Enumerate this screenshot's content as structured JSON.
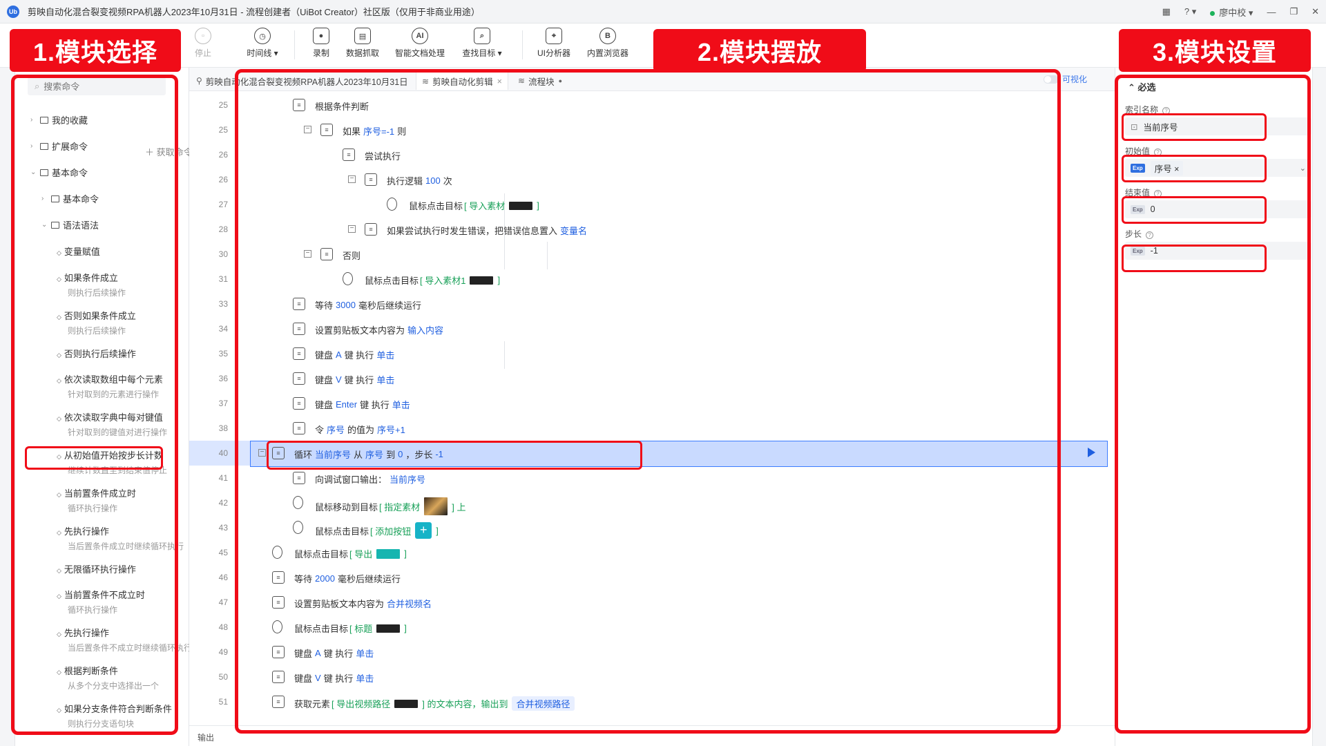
{
  "window": {
    "title": "剪映自动化混合裂变视频RPA机器人2023年10月31日 - 流程创建者（UiBot Creator）社区版（仅用于非商业用途）",
    "logo": "Ub",
    "user": "廖中校"
  },
  "toolbar": {
    "stop": "停止",
    "timeline": "时间线 ▾",
    "record": "录制",
    "data_capture": "数据抓取",
    "smart_doc": "智能文档处理",
    "find_target": "查找目标 ▾",
    "ui_analyzer": "UI分析器",
    "browser": "内置浏览器"
  },
  "annotations": {
    "label1": "1.模块选择",
    "label2": "2.模块摆放",
    "label3": "3.模块设置"
  },
  "left_panel": {
    "search_placeholder": "搜索命令",
    "get_command": "获取命令",
    "tree": [
      "我的收藏",
      "扩展命令",
      "基本命令",
      "基本命令",
      "语法语法"
    ],
    "commands": [
      {
        "title": "变量赋值",
        "sub": ""
      },
      {
        "title": "如果条件成立",
        "sub": "则执行后续操作"
      },
      {
        "title": "否则如果条件成立",
        "sub": "则执行后续操作"
      },
      {
        "title": "否则执行后续操作",
        "sub": ""
      },
      {
        "title": "依次读取数组中每个元素",
        "sub": "针对取到的元素进行操作"
      },
      {
        "title": "依次读取字典中每对键值",
        "sub": "针对取到的键值对进行操作"
      },
      {
        "title": "从初始值开始按步长计数",
        "sub": "继续计数直至到结束值停止"
      },
      {
        "title": "当前置条件成立时",
        "sub": "循环执行操作"
      },
      {
        "title": "先执行操作",
        "sub": "当后置条件成立时继续循环执行"
      },
      {
        "title": "无限循环执行操作",
        "sub": ""
      },
      {
        "title": "当前置条件不成立时",
        "sub": "循环执行操作"
      },
      {
        "title": "先执行操作",
        "sub": "当后置条件不成立时继续循环执行"
      },
      {
        "title": "根据判断条件",
        "sub": "从多个分支中选择出一个"
      },
      {
        "title": "如果分支条件符合判断条件",
        "sub": "则执行分支语句块"
      }
    ]
  },
  "editor": {
    "tabs": [
      "剪映自动化混合裂变视频RPA机器人2023年10月31日",
      "剪映自动化剪辑",
      "流程块"
    ],
    "visualize": "可视化",
    "output": "输出",
    "rows": [
      {
        "ln": "25",
        "parts": [
          "根据条件判断"
        ]
      },
      {
        "ln": "25",
        "pre": "如果",
        "var": "序号=-1",
        "post": "则"
      },
      {
        "ln": "26",
        "parts": [
          "尝试执行"
        ]
      },
      {
        "ln": "26",
        "pre": "执行逻辑",
        "var": "100",
        "post": "次"
      },
      {
        "ln": "27",
        "pre": "鼠标点击目标",
        "tag": "[ 导入素材",
        "tagend": "]"
      },
      {
        "ln": "28",
        "pre": "如果尝试执行时发生错误，把错误信息置入",
        "var": "变量名",
        "post": ""
      },
      {
        "ln": "30",
        "parts": [
          "否则"
        ]
      },
      {
        "ln": "31",
        "pre": "鼠标点击目标",
        "tag": "[ 导入素材1",
        "tagend": "]"
      },
      {
        "ln": "33",
        "pre": "等待",
        "var": "3000",
        "post": "毫秒后继续运行"
      },
      {
        "ln": "34",
        "pre": "设置剪贴板文本内容为",
        "var": "输入内容",
        "post": ""
      },
      {
        "ln": "35",
        "pre": "键盘",
        "var": "A",
        "post": "键 执行",
        "var2": "单击"
      },
      {
        "ln": "36",
        "pre": "键盘",
        "var": "V",
        "post": "键 执行",
        "var2": "单击"
      },
      {
        "ln": "37",
        "pre": "键盘",
        "var": "Enter",
        "post": "键 执行",
        "var2": "单击"
      },
      {
        "ln": "38",
        "pre": "令",
        "var": "序号",
        "post": "的值为",
        "var2": "序号+1"
      },
      {
        "ln": "40",
        "pre": "循环",
        "var": "当前序号",
        "post": "从",
        "var2": "序号",
        "post2": "到",
        "var3": "0",
        "post3": "，步长",
        "var4": "-1"
      },
      {
        "ln": "41",
        "pre": "向调试窗口输出：",
        "var": "当前序号",
        "post": ""
      },
      {
        "ln": "42",
        "pre": "鼠标移动到目标",
        "tag": "[ 指定素材",
        "tagend": "] 上"
      },
      {
        "ln": "43",
        "pre": "鼠标点击目标",
        "tag": "[ 添加按钮",
        "tagend": "]"
      },
      {
        "ln": "45",
        "pre": "鼠标点击目标",
        "tag": "[ 导出",
        "tagend": "]"
      },
      {
        "ln": "46",
        "pre": "等待",
        "var": "2000",
        "post": "毫秒后继续运行"
      },
      {
        "ln": "47",
        "pre": "设置剪贴板文本内容为",
        "var": "合并视频名",
        "post": ""
      },
      {
        "ln": "48",
        "pre": "鼠标点击目标",
        "tag": "[ 标题",
        "tagend": "]"
      },
      {
        "ln": "49",
        "pre": "键盘",
        "var": "A",
        "post": "键 执行",
        "var2": "单击"
      },
      {
        "ln": "50",
        "pre": "键盘",
        "var": "V",
        "post": "键 执行",
        "var2": "单击"
      },
      {
        "ln": "51",
        "pre": "获取元素",
        "tag": "[ 导出视频路径",
        "tagend": "] 的文本内容，输出到",
        "pill": "合并视频路径"
      }
    ]
  },
  "right_panel": {
    "section": "必选",
    "index_label": "索引名称",
    "index_value": "当前序号",
    "init_label": "初始值",
    "init_value": "序号",
    "end_label": "结束值",
    "end_value": "0",
    "step_label": "步长",
    "step_value": "-1",
    "exp": "Exp"
  },
  "colors": {
    "annotation_red": "#f00c18",
    "keyword_blue": "#1f5fe0",
    "target_green": "#18a058",
    "selected_row": "#c9daff"
  }
}
